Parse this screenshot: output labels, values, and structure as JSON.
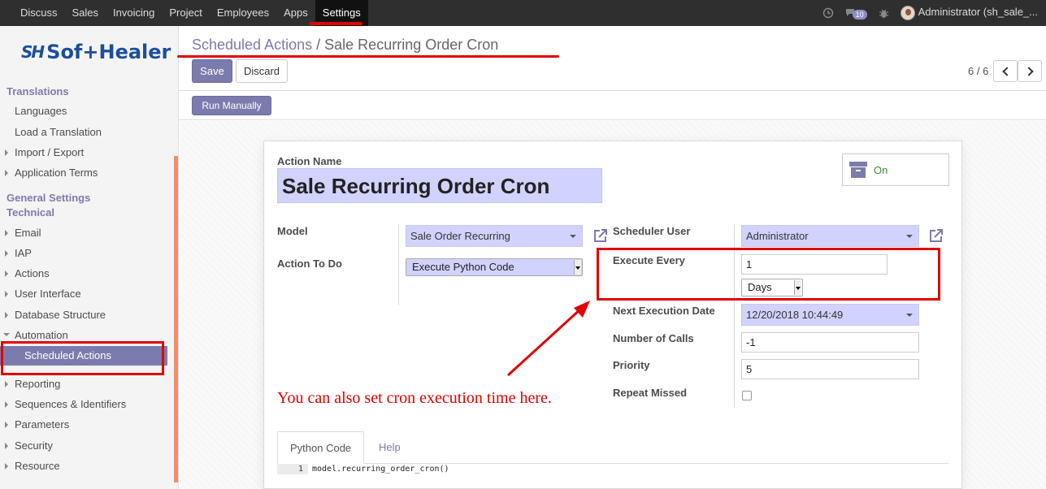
{
  "navbar": {
    "menu": [
      "Discuss",
      "Sales",
      "Invoicing",
      "Project",
      "Employees",
      "Apps",
      "Settings"
    ],
    "active": "Settings",
    "message_count": "10",
    "user": "Administrator (sh_sale_..."
  },
  "sidebar": {
    "logo_mark": "SH",
    "logo_text": "Sof+Healer",
    "translations_head": "Translations",
    "items_translations": [
      "Languages",
      "Load a Translation",
      "Import / Export",
      "Application Terms"
    ],
    "general_head": "General Settings",
    "technical_head": "Technical",
    "items_technical": [
      "Email",
      "IAP",
      "Actions",
      "User Interface",
      "Database Structure",
      "Automation"
    ],
    "active_item": "Scheduled Actions",
    "items_after": [
      "Reporting",
      "Sequences & Identifiers",
      "Parameters",
      "Security",
      "Resource"
    ]
  },
  "breadcrumb": {
    "parent": "Scheduled Actions",
    "separator": "/",
    "current": "Sale Recurring Order Cron"
  },
  "buttons": {
    "save": "Save",
    "discard": "Discard",
    "run_manually": "Run Manually"
  },
  "pager": {
    "text": "6 / 6"
  },
  "form": {
    "action_name_label": "Action Name",
    "action_name": "Sale Recurring Order Cron",
    "active_toggle": "On",
    "model_label": "Model",
    "model_value": "Sale Order Recurring",
    "action_to_do_label": "Action To Do",
    "action_to_do_value": "Execute Python Code",
    "scheduler_user_label": "Scheduler User",
    "scheduler_user_value": "Administrator",
    "execute_every_label": "Execute Every",
    "execute_every_value": "1",
    "interval_unit": "Days",
    "next_exec_label": "Next Execution Date",
    "next_exec_value": "12/20/2018 10:44:49",
    "calls_label": "Number of Calls",
    "calls_value": "-1",
    "priority_label": "Priority",
    "priority_value": "5",
    "repeat_missed_label": "Repeat Missed"
  },
  "annotation": "You can also set cron execution time here.",
  "tabs": [
    "Python Code",
    "Help"
  ],
  "code": {
    "line_no": "1",
    "text": "model.recurring_order_cron()"
  },
  "colors": {
    "accent": "#7c7bad",
    "annotation_red": "#e10000",
    "field_bg": "#d2d2ff",
    "navbar": "#2f2f2f"
  }
}
